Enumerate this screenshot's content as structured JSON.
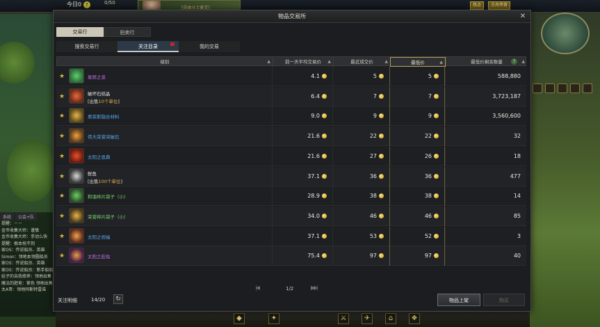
{
  "hud": {
    "today_label": "今日0",
    "help_icon_text": "?",
    "progress_count": "0/50",
    "center_banner": "[自由斗士麦克]",
    "btn_right1": "热点",
    "btn_right2": "方舟传奇"
  },
  "chat": {
    "tabs": [
      "系统",
      "公会+队"
    ],
    "lines": [
      "提醒：－－",
      "金币收集大师：谨慎",
      "金币收集大师：手动么快",
      "提醒：根本抢不到",
      "家OS：传说船员、英雄",
      "Simon：领地本领圆船员",
      "家OS：传说船员、英雄",
      "家OS：传说船员：新手船船员",
      "娃子的自我修养：领地出售",
      "魔法的肥皂：紫色 领地出售",
      "太A哥：领地同斯特雷诺"
    ]
  },
  "window": {
    "title": "物品交易所",
    "close_glyph": "✕",
    "tabs_top": [
      "交易行",
      "拍卖行"
    ],
    "tabs_second": [
      "搜索交易行",
      "关注目录",
      "我的交易"
    ],
    "columns": {
      "category": "级别",
      "avg_price": "前一天平均交易价",
      "recent_price": "最近成交价",
      "lowest_price": "最低价",
      "lowest_qty": "最低价剩余数量"
    },
    "help_glyph": "?",
    "sort_glyph": "▲",
    "star_glyph": "★",
    "rows": [
      {
        "name": "星辰之息",
        "name_color": "#c070e8",
        "sub_pre": "",
        "sub_hl": "",
        "sub_post": "",
        "avg": "4.1",
        "recent": "5",
        "lowest": "5",
        "qty": "588,880",
        "icon_bg": "#2f6a3a",
        "icon_fg": "#5ad06a"
      },
      {
        "name": "破坏石结晶",
        "name_color": "#e8e8e0",
        "sub_pre": "[出售",
        "sub_hl": "10个单位",
        "sub_post": "]",
        "avg": "6.4",
        "recent": "7",
        "lowest": "7",
        "qty": "3,723,187",
        "icon_bg": "#6a2a1a",
        "icon_fg": "#e86a3a"
      },
      {
        "name": "奥菲斯融合材料",
        "name_color": "#5aa8e8",
        "sub_pre": "",
        "sub_hl": "",
        "sub_post": "",
        "avg": "9.0",
        "recent": "9",
        "lowest": "9",
        "qty": "3,560,600",
        "icon_bg": "#5a4a1a",
        "icon_fg": "#e8b44a"
      },
      {
        "name": "伟大荣誉突破石",
        "name_color": "#5aa8e8",
        "sub_pre": "",
        "sub_hl": "",
        "sub_post": "",
        "avg": "21.6",
        "recent": "22",
        "lowest": "22",
        "qty": "32",
        "icon_bg": "#5a3a1a",
        "icon_fg": "#f0a040"
      },
      {
        "name": "太阳之恩典",
        "name_color": "#5aa8e8",
        "sub_pre": "",
        "sub_hl": "",
        "sub_post": "",
        "avg": "21.6",
        "recent": "27",
        "lowest": "26",
        "qty": "18",
        "icon_bg": "#6a1a10",
        "icon_fg": "#e8502a"
      },
      {
        "name": "鲜鱼",
        "name_color": "#e8e8e0",
        "sub_pre": "[出售",
        "sub_hl": "100个单位",
        "sub_post": "]",
        "avg": "37.1",
        "recent": "36",
        "lowest": "36",
        "qty": "477",
        "icon_bg": "#3a3a3a",
        "icon_fg": "#d8d8d8"
      },
      {
        "name": "和谐碎片袋子（小）",
        "name_color": "#7ad86a",
        "sub_pre": "",
        "sub_hl": "",
        "sub_post": "",
        "avg": "28.9",
        "recent": "38",
        "lowest": "38",
        "qty": "14",
        "icon_bg": "#2a4a2a",
        "icon_fg": "#6ad05a"
      },
      {
        "name": "荣誉碎片袋子（小）",
        "name_color": "#7ad86a",
        "sub_pre": "",
        "sub_hl": "",
        "sub_post": "",
        "avg": "34.0",
        "recent": "46",
        "lowest": "46",
        "qty": "85",
        "icon_bg": "#4a3a1a",
        "icon_fg": "#e8b44a"
      },
      {
        "name": "太阳之祝福",
        "name_color": "#5aa8e8",
        "sub_pre": "",
        "sub_hl": "",
        "sub_post": "",
        "avg": "37.1",
        "recent": "53",
        "lowest": "52",
        "qty": "3",
        "icon_bg": "#5a2a1a",
        "icon_fg": "#f0a050"
      },
      {
        "name": "太阳之庇佑",
        "name_color": "#c070e8",
        "sub_pre": "",
        "sub_hl": "",
        "sub_post": "",
        "avg": "75.4",
        "recent": "97",
        "lowest": "97",
        "qty": "40",
        "icon_bg": "#4a1a4a",
        "icon_fg": "#e8a040"
      }
    ],
    "pager": {
      "first": "|◀",
      "prev_next": "▶▶|",
      "page": "1/2"
    },
    "footer": {
      "label": "关注明细",
      "count": "14/20",
      "refresh_glyph": "↻"
    },
    "btn_list": "物品上架",
    "btn_buy": "购买"
  },
  "bottom_icons": [
    "◆",
    "✦",
    "⚔",
    "✈",
    "⌂",
    "❖"
  ],
  "colors": {
    "accent_gold": "#d4b83c",
    "header_highlight": "#b49a5a",
    "epic_purple": "#c070e8",
    "rare_blue": "#5aa8e8",
    "uncommon_green": "#7ad86a"
  }
}
